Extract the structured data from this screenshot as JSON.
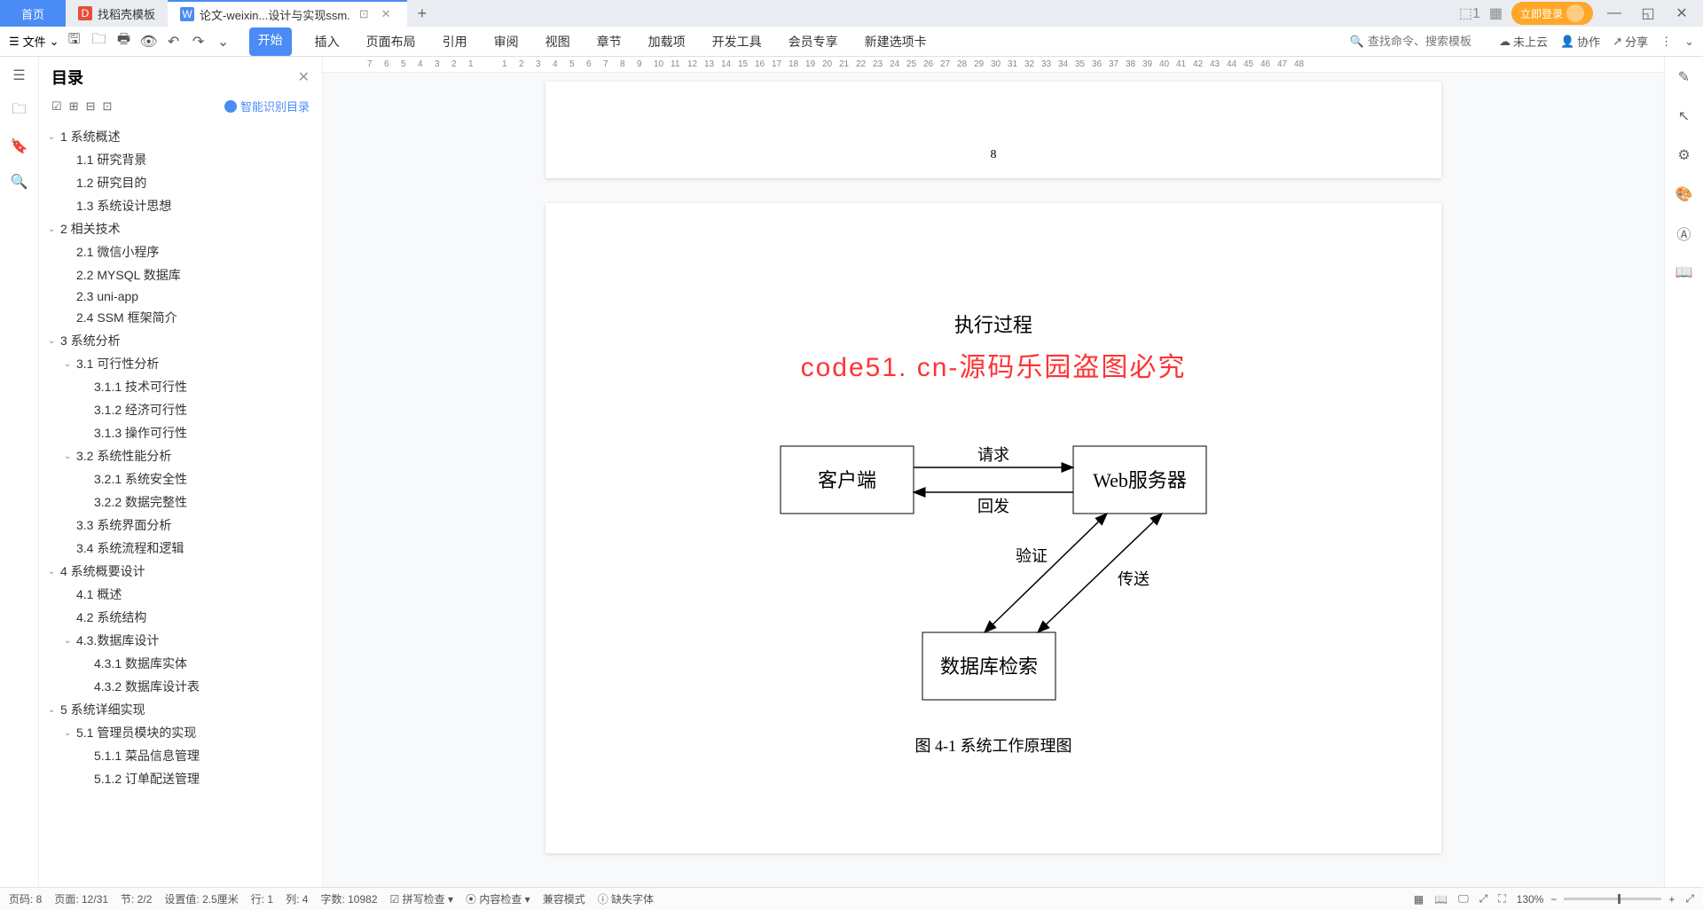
{
  "tabs": {
    "home": "首页",
    "t1": "找稻壳模板",
    "t2": "论文-weixin...设计与实现ssm.",
    "login": "立即登录"
  },
  "ribbon": {
    "file": "文件",
    "tabs": [
      "开始",
      "插入",
      "页面布局",
      "引用",
      "审阅",
      "视图",
      "章节",
      "加载项",
      "开发工具",
      "会员专享",
      "新建选项卡"
    ],
    "search_ph": "查找命令、搜索模板",
    "cloud": "未上云",
    "collab": "协作",
    "share": "分享"
  },
  "sidebar": {
    "title": "目录",
    "smart": "智能识别目录",
    "items": [
      {
        "l": 0,
        "c": true,
        "t": "1 系统概述"
      },
      {
        "l": 1,
        "t": "1.1 研究背景"
      },
      {
        "l": 1,
        "t": "1.2 研究目的"
      },
      {
        "l": 1,
        "t": "1.3 系统设计思想"
      },
      {
        "l": 0,
        "c": true,
        "t": "2 相关技术"
      },
      {
        "l": 1,
        "t": "2.1 微信小程序"
      },
      {
        "l": 1,
        "t": "2.2 MYSQL 数据库"
      },
      {
        "l": 1,
        "t": "2.3 uni-app"
      },
      {
        "l": 1,
        "t": "2.4 SSM 框架简介"
      },
      {
        "l": 0,
        "c": true,
        "t": "3 系统分析"
      },
      {
        "l": 1,
        "c": true,
        "t": "3.1 可行性分析"
      },
      {
        "l": 2,
        "t": "3.1.1 技术可行性"
      },
      {
        "l": 2,
        "t": "3.1.2 经济可行性"
      },
      {
        "l": 2,
        "t": "3.1.3 操作可行性"
      },
      {
        "l": 1,
        "c": true,
        "t": "3.2 系统性能分析"
      },
      {
        "l": 2,
        "t": "3.2.1 系统安全性"
      },
      {
        "l": 2,
        "t": "3.2.2 数据完整性"
      },
      {
        "l": 1,
        "t": "3.3 系统界面分析"
      },
      {
        "l": 1,
        "t": "3.4 系统流程和逻辑"
      },
      {
        "l": 0,
        "c": true,
        "t": "4 系统概要设计"
      },
      {
        "l": 1,
        "t": "4.1 概述"
      },
      {
        "l": 1,
        "t": "4.2 系统结构"
      },
      {
        "l": 1,
        "c": true,
        "t": "4.3.数据库设计"
      },
      {
        "l": 2,
        "t": "4.3.1 数据库实体"
      },
      {
        "l": 2,
        "t": "4.3.2 数据库设计表"
      },
      {
        "l": 0,
        "c": true,
        "t": "5 系统详细实现"
      },
      {
        "l": 1,
        "c": true,
        "t": "5.1 管理员模块的实现"
      },
      {
        "l": 2,
        "t": "5.1.1 菜品信息管理"
      },
      {
        "l": 2,
        "t": "5.1.2 订单配送管理"
      }
    ]
  },
  "doc": {
    "prev_page_no": "8",
    "heading": "执行过程",
    "watermark": "code51. cn-源码乐园盗图必究",
    "box_client": "客户端",
    "box_web": "Web服务器",
    "box_db": "数据库检索",
    "lbl_req": "请求",
    "lbl_resp": "回发",
    "lbl_verify": "验证",
    "lbl_send": "传送",
    "caption": "图 4-1 系统工作原理图"
  },
  "status": {
    "page_no": "页码: 8",
    "pages": "页面: 12/31",
    "section": "节: 2/2",
    "setting": "设置值: 2.5厘米",
    "row": "行: 1",
    "col": "列: 4",
    "words": "字数: 10982",
    "spell": "拼写检查",
    "content": "内容检查",
    "compat": "兼容模式",
    "missing": "缺失字体",
    "zoom": "130%"
  }
}
